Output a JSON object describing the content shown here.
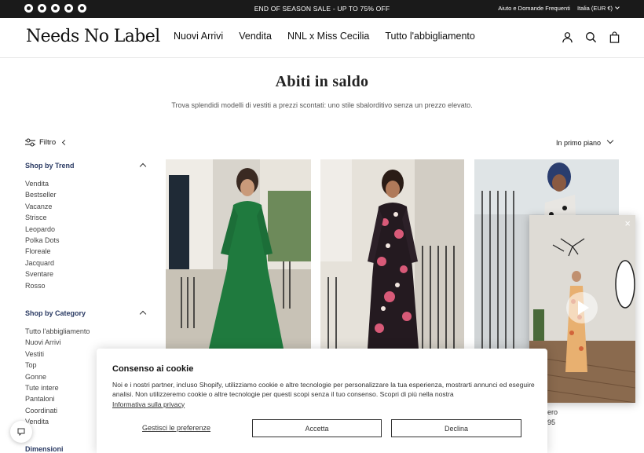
{
  "announcement": {
    "social_icons": [
      "facebook-icon",
      "instagram-icon",
      "tiktok-icon",
      "pinterest-icon",
      "linkedin-icon"
    ],
    "promo_text": "END OF SEASON SALE - UP TO 75% OFF",
    "help_link": "Aiuto e Domande Frequenti",
    "locale": "Italia (EUR €)"
  },
  "header": {
    "logo": "Needs No Label",
    "nav": [
      "Nuovi Arrivi",
      "Vendita",
      "NNL x Miss Cecilia",
      "Tutto l'abbigliamento"
    ],
    "icons": [
      "account-icon",
      "search-icon",
      "cart-icon"
    ]
  },
  "hero": {
    "title": "Abiti in saldo",
    "subtitle": "Trova splendidi modelli di vestiti a prezzi scontati: uno stile sbalorditivo senza un prezzo elevato."
  },
  "toolbar": {
    "filter_label": "Filtro",
    "sort_label": "In primo piano"
  },
  "sidebar": {
    "trend_heading": "Shop by Trend",
    "trend_items": [
      "Vendita",
      "Bestseller",
      "Vacanze",
      "Strisce",
      "Leopardo",
      "Polka Dots",
      "Floreale",
      "Jacquard",
      "Sventare",
      "Rosso"
    ],
    "category_heading": "Shop by Category",
    "category_items": [
      "Tutto l'abbigliamento",
      "Nuovi Arrivi",
      "Vestiti",
      "Top",
      "Gonne",
      "Tute intere",
      "Pantaloni",
      "Coordinati",
      "Vendita"
    ],
    "size_heading": "Dimensioni"
  },
  "products": [
    {
      "image": "green-maxi-dress"
    },
    {
      "image": "floral-black-dress"
    },
    {
      "image": "leopard-one-shoulder-dress"
    }
  ],
  "partial_text": {
    "line1": "ero",
    "price": "95"
  },
  "cookie": {
    "title": "Consenso ai cookie",
    "body": "Noi e i nostri partner, incluso Shopify, utilizziamo cookie e altre tecnologie per personalizzare la tua esperienza, mostrarti annunci ed eseguire analisi. Non utilizzeremo cookie o altre tecnologie per questi scopi senza il tuo consenso. Scopri di più nella nostra",
    "privacy_link": "Informativa sulla privacy",
    "manage_label": "Gestisci le preferenze",
    "accept_label": "Accetta",
    "decline_label": "Declina"
  },
  "video": {
    "close_label": "×"
  },
  "colors": {
    "topbar": "#1a1a1a",
    "heading_blue": "#2a3a63"
  }
}
